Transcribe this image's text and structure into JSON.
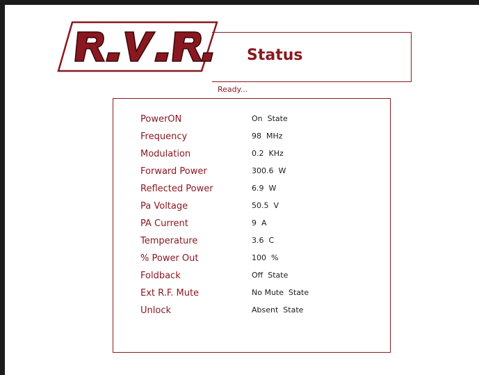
{
  "header": {
    "logo_text": "R.V.R.",
    "title": "Status",
    "status_message": "Ready..."
  },
  "colors": {
    "accent": "#8a1820",
    "text": "#1b1b1b",
    "frame": "#1b1b1b"
  },
  "rows": [
    {
      "label": "PowerON",
      "value": "On  State"
    },
    {
      "label": "Frequency",
      "value": "98  MHz"
    },
    {
      "label": "Modulation",
      "value": "0.2  KHz"
    },
    {
      "label": "Forward Power",
      "value": "300.6  W"
    },
    {
      "label": "Reflected Power",
      "value": "6.9  W"
    },
    {
      "label": "Pa Voltage",
      "value": "50.5  V"
    },
    {
      "label": "PA Current",
      "value": "9  A"
    },
    {
      "label": "Temperature",
      "value": "3.6  C"
    },
    {
      "label": "% Power Out",
      "value": "100  %"
    },
    {
      "label": "Foldback",
      "value": "Off  State"
    },
    {
      "label": "Ext R.F. Mute",
      "value": "No Mute  State"
    },
    {
      "label": "Unlock",
      "value": "Absent  State"
    }
  ]
}
